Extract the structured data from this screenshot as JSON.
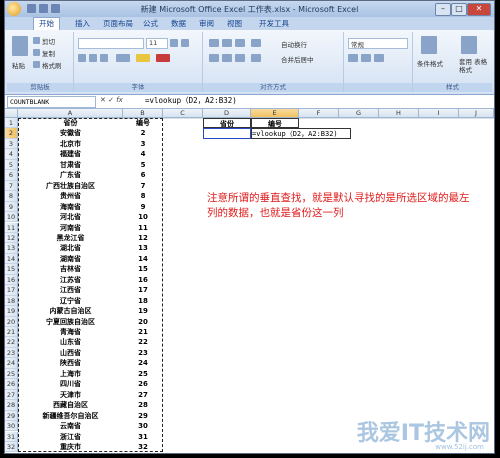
{
  "window": {
    "title": "新建 Microsoft Office Excel 工作表.xlsx - Microsoft Excel"
  },
  "tabs": [
    "开始",
    "插入",
    "页面布局",
    "公式",
    "数据",
    "审阅",
    "视图",
    "开发工具"
  ],
  "ribbon": {
    "paste": "粘贴",
    "cut": "剪切",
    "copy": "复制",
    "format_painter": "格式刷",
    "clipboard_group": "剪贴板",
    "font_group": "字体",
    "font_size": "11",
    "align_group": "对齐方式",
    "wrap_text": "自动换行",
    "merge_center": "合并后居中",
    "number_format": "常规",
    "cond_format": "条件格式",
    "table_format": "套用\n表格格式",
    "styles_group": "样式"
  },
  "formula_bar": {
    "name_box": "COUNTBLANK",
    "formula": "=vlookup（D2，A2:B32)"
  },
  "columns": [
    "A",
    "B",
    "C",
    "D",
    "E",
    "F",
    "G",
    "H",
    "I",
    "J"
  ],
  "headers": {
    "province": "省份",
    "code": "编号"
  },
  "rows": [
    [
      "安徽省",
      "2"
    ],
    [
      "北京市",
      "3"
    ],
    [
      "福建省",
      "4"
    ],
    [
      "甘肃省",
      "5"
    ],
    [
      "广东省",
      "6"
    ],
    [
      "广西壮族自治区",
      "7"
    ],
    [
      "贵州省",
      "8"
    ],
    [
      "海南省",
      "9"
    ],
    [
      "河北省",
      "10"
    ],
    [
      "河南省",
      "11"
    ],
    [
      "黑龙江省",
      "12"
    ],
    [
      "湖北省",
      "13"
    ],
    [
      "湖南省",
      "14"
    ],
    [
      "吉林省",
      "15"
    ],
    [
      "江苏省",
      "16"
    ],
    [
      "江西省",
      "17"
    ],
    [
      "辽宁省",
      "18"
    ],
    [
      "内蒙古自治区",
      "19"
    ],
    [
      "宁夏回族自治区",
      "20"
    ],
    [
      "青海省",
      "21"
    ],
    [
      "山东省",
      "22"
    ],
    [
      "山西省",
      "23"
    ],
    [
      "陕西省",
      "24"
    ],
    [
      "上海市",
      "25"
    ],
    [
      "四川省",
      "26"
    ],
    [
      "天津市",
      "27"
    ],
    [
      "西藏自治区",
      "28"
    ],
    [
      "新疆维吾尔自治区",
      "29"
    ],
    [
      "云南省",
      "30"
    ],
    [
      "浙江省",
      "31"
    ],
    [
      "重庆市",
      "32"
    ]
  ],
  "lookup_headers": {
    "d": "省份",
    "e": "编号"
  },
  "lookup_cell": "=vlookup（D2，A2:B32)",
  "note": "注意所谓的垂直查找，就是默认寻找的是所选区域的最左列的数据，也就是省份这一列",
  "watermark": {
    "main": "我爱IT技术网",
    "sub": "www.52ij.com"
  },
  "colors": {
    "accent": "#15428b",
    "note": "#e01b1b",
    "selection": "#f1c15f"
  }
}
